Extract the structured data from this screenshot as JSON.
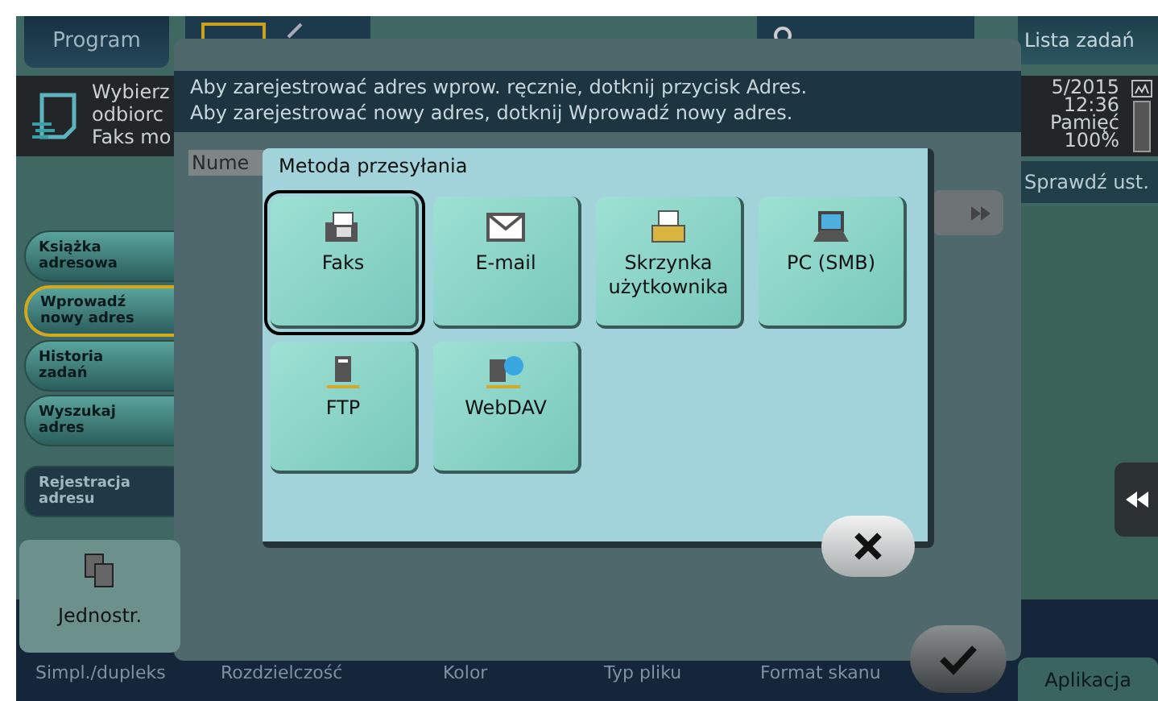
{
  "background_screen": {
    "top_tabs": [
      {
        "label": "Program"
      }
    ],
    "instruction_lines": [
      "Wybierz",
      "odbiorc",
      "Faks mo"
    ],
    "job_list_button": "Lista zadań",
    "status": {
      "date": "5/2015",
      "time": "12:36",
      "memory_label": "Pamięć",
      "memory_value": "100%"
    },
    "check_settings_button": "Sprawdź ust.",
    "side_menu": [
      {
        "label": "Książka adresowa",
        "kind": "tab",
        "selected": false
      },
      {
        "label": "Wprowadź nowy adres",
        "kind": "tab",
        "selected": true
      },
      {
        "label": "Historia zadań",
        "kind": "tab",
        "selected": false
      },
      {
        "label": "Wyszukaj adres",
        "kind": "tab",
        "selected": false
      },
      {
        "label": "Rejestracja adresu",
        "kind": "action",
        "selected": false
      }
    ],
    "duplex_tile": "Jednostr.",
    "bottom_tabs": [
      "Simpl./dupleks",
      "Rozdzielczość",
      "Kolor",
      "Typ pliku",
      "Format skanu"
    ],
    "app_button": "Aplikacja"
  },
  "dialog": {
    "messages": [
      "Aby zarejestrować adres wprow. ręcznie, dotknij przycisk Adres.",
      "Aby zarejestrować nowy adres, dotknij Wprowadź nowy adres."
    ],
    "number_label": "Nume"
  },
  "popup": {
    "title": "Metoda przesyłania",
    "methods": [
      {
        "label": "Faks",
        "kind": "fax",
        "selected": true
      },
      {
        "label": "E-mail",
        "kind": "email",
        "selected": false
      },
      {
        "label": "Skrzynka użytkownika",
        "kind": "box",
        "selected": false
      },
      {
        "label": "PC (SMB)",
        "kind": "pc",
        "selected": false
      },
      {
        "label": "FTP",
        "kind": "ftp",
        "selected": false
      },
      {
        "label": "WebDAV",
        "kind": "webdav",
        "selected": false
      }
    ]
  }
}
